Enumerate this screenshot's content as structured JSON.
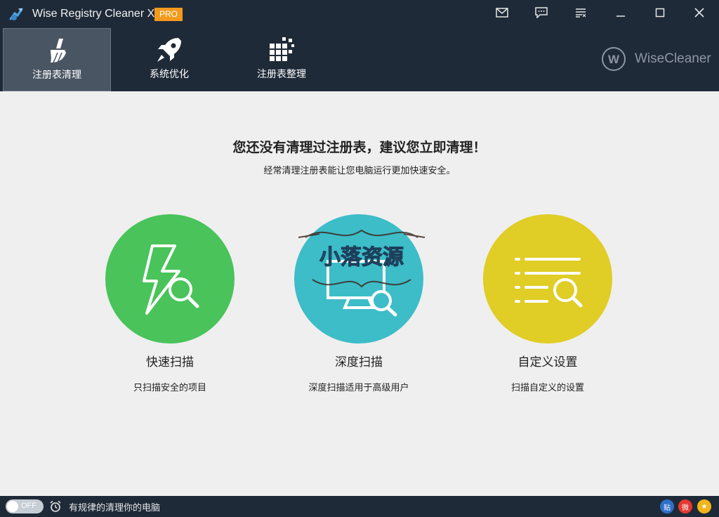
{
  "titlebar": {
    "title": "Wise Registry Cleaner X",
    "badge": "PRO",
    "icons": [
      "mail-icon",
      "feedback-icon",
      "menu-icon",
      "minimize-icon",
      "maximize-icon",
      "close-icon"
    ]
  },
  "tabs": [
    {
      "label": "注册表清理",
      "icon": "broom-icon",
      "active": true
    },
    {
      "label": "系统优化",
      "icon": "rocket-icon",
      "active": false
    },
    {
      "label": "注册表整理",
      "icon": "defrag-grid-icon",
      "active": false
    }
  ],
  "brand": {
    "text": "WiseCleaner",
    "logo_letter": "W"
  },
  "main": {
    "headline": "您还没有清理过注册表，建议您立即清理！",
    "subline": "经常清理注册表能让您电脑运行更加快速安全。"
  },
  "options": [
    {
      "title": "快速扫描",
      "desc": "只扫描安全的项目",
      "color": "#49c35a",
      "icon": "lightning-search-icon"
    },
    {
      "title": "深度扫描",
      "desc": "深度扫描适用于高级用户",
      "color": "#3cbdc8",
      "icon": "monitor-search-icon"
    },
    {
      "title": "自定义设置",
      "desc": "扫描自定义的设置",
      "color": "#e0cd25",
      "icon": "list-search-icon"
    }
  ],
  "watermark": {
    "text": "小落资源"
  },
  "statusbar": {
    "toggle_label": "OFF",
    "text": "有规律的清理你的电脑",
    "social": [
      {
        "label": "贴",
        "color": "#2e6fc9",
        "icon": "tieba-icon"
      },
      {
        "label": "微",
        "color": "#e6382f",
        "icon": "weibo-icon"
      },
      {
        "label": "★",
        "color": "#f1b51c",
        "icon": "star-icon"
      }
    ]
  },
  "colors": {
    "header_bg": "#1f2a38",
    "pro_badge": "#f39a1e",
    "body_bg": "#efefef"
  }
}
